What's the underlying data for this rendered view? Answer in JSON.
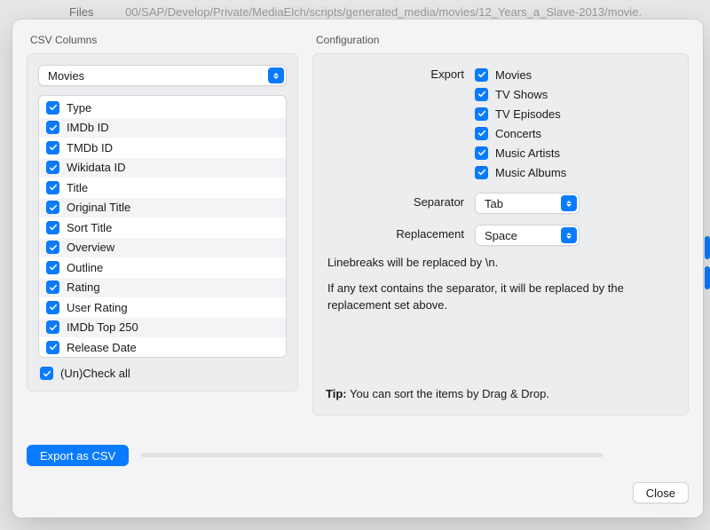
{
  "background": {
    "label": "Files",
    "path": "00/SAP/Develop/Private/MediaElch/scripts/generated_media/movies/12_Years_a_Slave-2013/movie."
  },
  "leftPanel": {
    "title": "CSV Columns",
    "source_selected": "Movies",
    "columns": [
      "Type",
      "IMDb ID",
      "TMDb ID",
      "Wikidata ID",
      "Title",
      "Original Title",
      "Sort Title",
      "Overview",
      "Outline",
      "Rating",
      "User Rating",
      "IMDb Top 250",
      "Release Date"
    ],
    "check_all_label": "(Un)Check all"
  },
  "rightPanel": {
    "title": "Configuration",
    "export_label": "Export",
    "export_items": [
      "Movies",
      "TV Shows",
      "TV Episodes",
      "Concerts",
      "Music Artists",
      "Music Albums"
    ],
    "separator_label": "Separator",
    "separator_value": "Tab",
    "replacement_label": "Replacement",
    "replacement_value": "Space",
    "note1": "Linebreaks will be replaced by \\n.",
    "note2": "If any text contains the separator, it will be replaced by the replacement set above.",
    "tip_label": "Tip:",
    "tip_text": " You can sort the items by Drag & Drop."
  },
  "footer": {
    "export_button": "Export as CSV",
    "close_button": "Close"
  }
}
